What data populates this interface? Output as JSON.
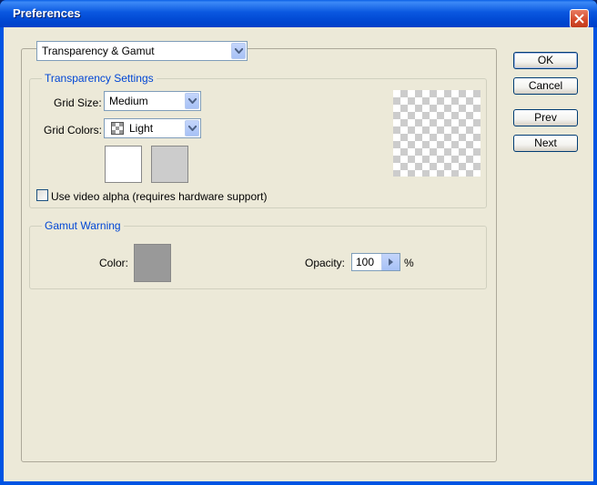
{
  "window": {
    "title": "Preferences"
  },
  "section_select": {
    "value": "Transparency & Gamut"
  },
  "transparency": {
    "legend": "Transparency Settings",
    "grid_size_label": "Grid Size:",
    "grid_size_value": "Medium",
    "grid_colors_label": "Grid Colors:",
    "grid_colors_value": "Light",
    "swatch1_color": "#ffffff",
    "swatch2_color": "#cccccc",
    "video_alpha_label": "Use video alpha (requires hardware support)",
    "video_alpha_checked": false
  },
  "gamut": {
    "legend": "Gamut Warning",
    "color_label": "Color:",
    "color_value": "#999999",
    "opacity_label": "Opacity:",
    "opacity_value": "100",
    "opacity_unit": "%"
  },
  "buttons": {
    "ok": "OK",
    "cancel": "Cancel",
    "prev": "Prev",
    "next": "Next"
  }
}
